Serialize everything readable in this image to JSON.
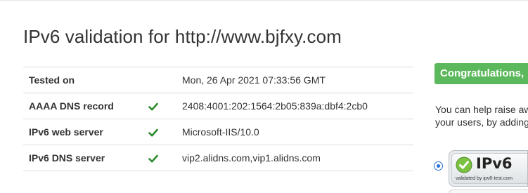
{
  "page": {
    "title": "IPv6 validation for http://www.bjfxy.com"
  },
  "results": {
    "rows": [
      {
        "label": "Tested on",
        "status": "",
        "value": "Mon, 26 Apr 2021 07:33:56 GMT"
      },
      {
        "label": "AAAA DNS record",
        "status": "check",
        "value": "2408:4001:202:1564:2b05:839a:dbf4:2cb0"
      },
      {
        "label": "IPv6 web server",
        "status": "check",
        "value": "Microsoft-IIS/10.0"
      },
      {
        "label": "IPv6 DNS server",
        "status": "check",
        "value": "vip2.alidns.com,vip1.alidns.com"
      }
    ]
  },
  "sidebar": {
    "banner": "Congratulations,",
    "help_line1": "You can help raise aw",
    "help_line2": "your users, by adding",
    "badge_main": "IPv6",
    "badge_sub": "validated by ipv6-test.com"
  },
  "colors": {
    "success_green": "#5cb85c",
    "check_green": "#2e8b2e",
    "radio_blue": "#2a6fd6"
  }
}
